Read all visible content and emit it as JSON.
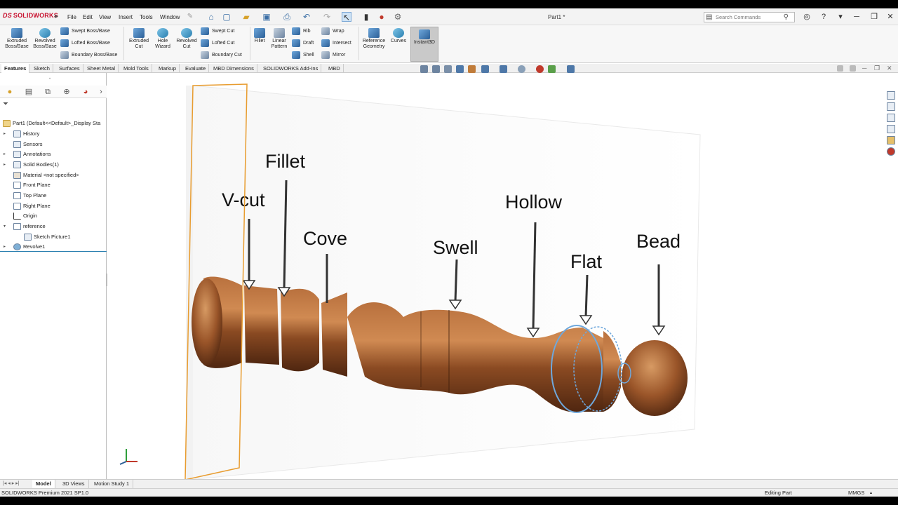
{
  "app": {
    "logo": "SOLIDWORKS",
    "logo_prefix": "DS",
    "document_title": "Part1 *"
  },
  "menu": [
    "File",
    "Edit",
    "View",
    "Insert",
    "Tools",
    "Window"
  ],
  "search": {
    "placeholder": "Search Commands"
  },
  "features_toolbar": {
    "extruded_boss": "Extruded Boss/Base",
    "revolved_boss": "Revolved Boss/Base",
    "swept_boss": "Swept Boss/Base",
    "lofted_boss": "Lofted Boss/Base",
    "boundary_boss": "Boundary Boss/Base",
    "extruded_cut": "Extruded Cut",
    "hole_wizard": "Hole Wizard",
    "revolved_cut": "Revolved Cut",
    "swept_cut": "Swept Cut",
    "lofted_cut": "Lofted Cut",
    "boundary_cut": "Boundary Cut",
    "fillet": "Fillet",
    "linear_pattern": "Linear Pattern",
    "rib": "Rib",
    "draft": "Draft",
    "shell": "Shell",
    "wrap": "Wrap",
    "intersect": "Intersect",
    "mirror": "Mirror",
    "reference_geometry": "Reference Geometry",
    "curves": "Curves",
    "instant3d": "Instant3D"
  },
  "tabs": [
    "Features",
    "Sketch",
    "Surfaces",
    "Sheet Metal",
    "Mold Tools",
    "Markup",
    "Evaluate",
    "MBD Dimensions",
    "SOLIDWORKS Add-Ins",
    "MBD"
  ],
  "tree": {
    "root": "Part1  (Default<<Default>_Display Sta",
    "items": [
      "History",
      "Sensors",
      "Annotations",
      "Solid Bodies(1)",
      "Material <not specified>",
      "Front Plane",
      "Top Plane",
      "Right Plane",
      "Origin",
      "reference",
      "Sketch Picture1",
      "Revolve1"
    ]
  },
  "bottom_tabs": [
    "Model",
    "3D Views",
    "Motion Study 1"
  ],
  "status": {
    "product": "SOLIDWORKS Premium 2021 SP1.0",
    "mode": "Editing Part",
    "units": "MMGS"
  },
  "reference_labels": [
    "V-cut",
    "Fillet",
    "Cove",
    "Swell",
    "Hollow",
    "Flat",
    "Bead"
  ],
  "colors": {
    "wood": "#8a4a22",
    "selection": "#6fa8dc",
    "plane": "#e89c2f",
    "ribbon_bg": "#f7f7f7"
  },
  "icons": [
    "home-icon",
    "new-doc-icon",
    "open-icon",
    "save-icon",
    "print-icon",
    "undo-icon",
    "select-icon",
    "options-icon",
    "search-icon",
    "user-icon",
    "help-icon"
  ]
}
